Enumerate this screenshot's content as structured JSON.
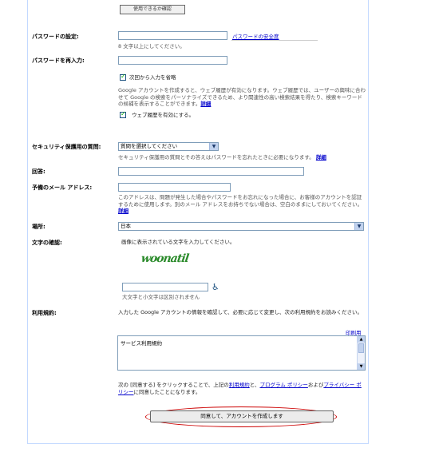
{
  "top": {
    "check_availability_button": "使用できるか確認"
  },
  "password": {
    "label": "パスワードの設定:",
    "strength_link": "パスワードの安全度",
    "hint": "8 文字以上にしてください。"
  },
  "password_confirm": {
    "label": "パスワードを再入力:"
  },
  "remember": {
    "label": "次回から入力を省略"
  },
  "web_history": {
    "description": "Google アカウントを作成すると、ウェブ履歴が有効になります。ウェブ履歴では、ユーザーの興味に合わせて Google の検索をパーソナライズできるため、より関連性の高い検索結果を得たり、検索キーワードの候補を表示することができます。",
    "details_link": "詳細",
    "checkbox_label": "ウェブ履歴を有効にする。"
  },
  "security_question": {
    "label": "セキュリティ保護用の質問:",
    "select_value": "質問を選択してください",
    "hint": "セキュリティ保護用の質問とその答えはパスワードを忘れたときに必要になります。",
    "details_link": "詳細"
  },
  "answer": {
    "label": "回答:"
  },
  "recovery_email": {
    "label": "予備のメール アドレス:",
    "hint": "このアドレスは、問題が発生した場合やパスワードをお忘れになった場合に、お客様のアカウントを認証するために使用します。別のメール アドレスをお持ちでない場合は、空白のままにしておいてください。",
    "details_link": "詳細"
  },
  "location": {
    "label": "場所:",
    "select_value": "日本"
  },
  "captcha": {
    "label": "文字の確認:",
    "instruction": "画像に表示されている文字を入力してください。",
    "image_text": "woonatil",
    "case_hint": "大文字と小文字は区別されません"
  },
  "terms": {
    "label": "利用規約:",
    "intro": "入力した Google アカウントの情報を確認して、必要に応じて変更し、次の利用規約をお読みください。",
    "print_link": "印刷用",
    "box_title": "サービス利用規約",
    "agreement_prefix": "次の [同意する] をクリックすることで、上記の",
    "tos_link": "利用規約",
    "and": "と、",
    "program_policy_link": "プログラム ポリシー",
    "and2": "および",
    "privacy_link": "プライバシー ポリシー",
    "agreement_suffix": "に同意したことになります。"
  },
  "submit": {
    "label": "同意して、アカウントを作成します"
  },
  "colors": {
    "link": "#0000cc",
    "border": "#7f9db9",
    "highlight": "#cc0000"
  }
}
